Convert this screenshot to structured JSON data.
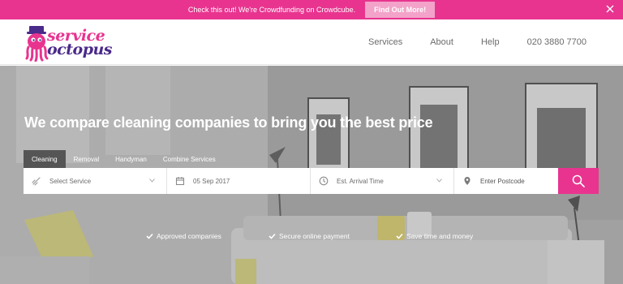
{
  "promo": {
    "text": "Check this out! We're Crowdfunding on Crowdcube.",
    "button": "Find Out More!",
    "close_icon": "close-icon"
  },
  "logo": {
    "line1": "service",
    "line2": "octopus"
  },
  "nav": {
    "items": [
      "Services",
      "About",
      "Help",
      "020 3880 7700"
    ]
  },
  "hero": {
    "title": "We compare cleaning companies to bring you the best price",
    "tabs": [
      "Cleaning",
      "Removal",
      "Handyman",
      "Combine Services"
    ],
    "active_tab": "Cleaning",
    "search": {
      "service_placeholder": "Select Service",
      "date_value": "05 Sep 2017",
      "arrival_placeholder": "Est. Arrival Time",
      "postcode_placeholder": "Enter Postcode"
    },
    "features": [
      "Approved companies",
      "Secure online payment",
      "Save time and money"
    ]
  },
  "colors": {
    "brand_pink": "#e8348f",
    "brand_purple": "#4a2a8a",
    "promo_button": "#f3a3c9",
    "active_tab": "#555555"
  }
}
